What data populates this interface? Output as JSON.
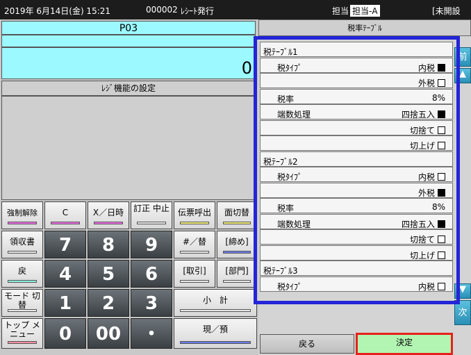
{
  "topbar": {
    "date": "2019年 6月14日(金) 15:21",
    "receipt_no": "000002",
    "mode": "ﾚｼｰﾄ発行",
    "tanto_label": "担当",
    "tanto_value": "担当-A",
    "status": "[未開設"
  },
  "display": {
    "title": "P03",
    "amount": "0"
  },
  "func_title": "ﾚｼﾞ機能の設定",
  "keys": {
    "force_release": "強制解除",
    "clear": "C",
    "x_date": "X／日時",
    "correct": "訂正 中止",
    "slip": "伝票呼出",
    "face": "面切替",
    "receipt": "領収書",
    "back": "戻",
    "hash": "#／替",
    "shime": "[締め]",
    "torihiki": "[取引]",
    "bumon": "[部門]",
    "mode_switch": "モード 切替",
    "top_menu": "トップ メニュー",
    "subtotal": "小　計",
    "cash": "現／預"
  },
  "numkeys": [
    "7",
    "8",
    "9",
    "4",
    "5",
    "6",
    "1",
    "2",
    "3",
    "0",
    "00",
    "・"
  ],
  "panel": {
    "title": "税率ﾃｰﾌﾞﾙ",
    "rows": [
      {
        "label": "税ﾃｰﾌﾞﾙ1",
        "value": "",
        "check": ""
      },
      {
        "label": "税ﾀｲﾌﾟ",
        "value": "内税",
        "check": "on"
      },
      {
        "label": "",
        "value": "外税",
        "check": "off"
      },
      {
        "label": "税率",
        "value": "8%",
        "check": ""
      },
      {
        "label": "端数処理",
        "value": "四捨五入",
        "check": "on"
      },
      {
        "label": "",
        "value": "切捨て",
        "check": "off"
      },
      {
        "label": "",
        "value": "切上げ",
        "check": "off"
      },
      {
        "label": "税ﾃｰﾌﾞﾙ2",
        "value": "",
        "check": ""
      },
      {
        "label": "税ﾀｲﾌﾟ",
        "value": "内税",
        "check": "off"
      },
      {
        "label": "",
        "value": "外税",
        "check": "on"
      },
      {
        "label": "税率",
        "value": "8%",
        "check": ""
      },
      {
        "label": "端数処理",
        "value": "四捨五入",
        "check": "on"
      },
      {
        "label": "",
        "value": "切捨て",
        "check": "off"
      },
      {
        "label": "",
        "value": "切上げ",
        "check": "off"
      },
      {
        "label": "税ﾃｰﾌﾞﾙ3",
        "value": "",
        "check": ""
      },
      {
        "label": "税ﾀｲﾌﾟ",
        "value": "内税",
        "check": "off"
      }
    ],
    "prev": "前",
    "next": "次",
    "back": "戻る",
    "ok": "決定"
  },
  "colors": {
    "highlight": "#2424d8",
    "ok_border": "#e8201a"
  }
}
